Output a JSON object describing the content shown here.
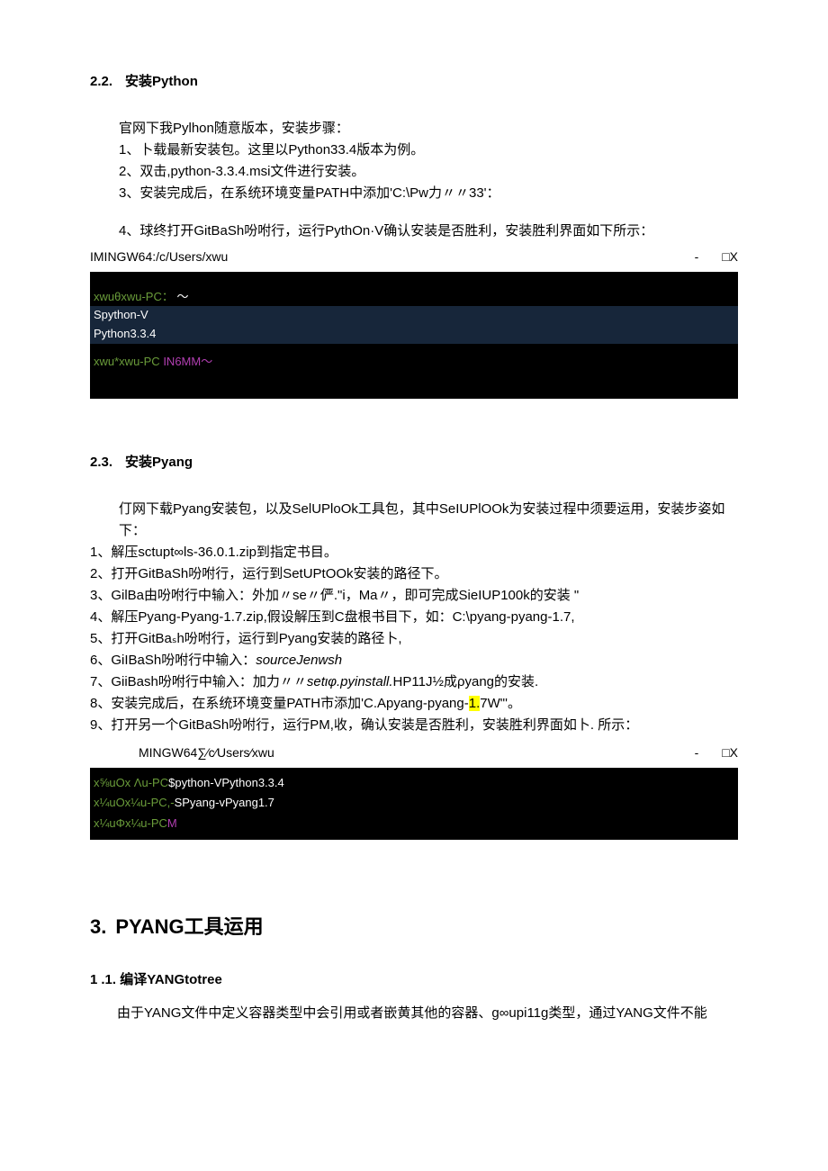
{
  "sec22": {
    "num": "2.2.",
    "title": "安装Python",
    "intro": "官网下我Pylhon随意版本，安装步骤：",
    "step1": "1、卜载最新安装包。这里以Python33.4版本为例。",
    "step2": "2、双击,python-3.3.4.msi文件进行安装。",
    "step3": "3、安装完成后，在系统环境变量PATH中添加'C:\\Pw力〃〃33'：",
    "step4": "4、球终打开GitBaSh吩咐行，运行PythOn·V确认安装是否胜利，安装胜利界面如下所示：",
    "term_title_left": "IMINGW64:/c/Users/xwu",
    "term_ctrl_min": "-",
    "term_ctrl_box": "□X",
    "t1l1_a": "xwuθxwu-PC：",
    "t1l1_b": "～",
    "t1l2": "Spython-V",
    "t1l3": "Python3.3.4",
    "t1l4_a": "xwu*xwu-PC",
    "t1l4_b": "IN6MM～"
  },
  "sec23": {
    "num": "2.3.",
    "title": "安装Pyang",
    "intro": "仃网下载Pyang安装包，以及SelUPloOk工具包，其中SeIUPlOOk为安装过程中须要运用，安装步姿如下：",
    "s1": "1、解压sctupt∞ls-36.0.1.zip到指定书目。",
    "s2": "2、打开GitBaSh吩咐行，运行到SetUPtOOk安装的路径下。",
    "s3": "3、GilBa由吩咐行中输入：外加〃se〃俨.\"i，Ma〃，即可完成SieIUP100k的安装 \"",
    "s4": "4、解压Pyang-Pyang-1.7.zip,假设解压到C盘根书目下，如：C:\\pyang-pyang-1.7,",
    "s5": "5、打开GitBaₛh吩咐行，运行到Pyang安装的路径卜,",
    "s6a": "6、GiIBaSh吩咐行中输入：",
    "s6b": "sourceJenwsh",
    "s7a": "7、GiiBash吩咐行中输入：加力〃〃",
    "s7b": "setιφ.pyinstall.",
    "s7c": "HP11J½成ρyang的安装.",
    "s8a": "8、安装完成后，在系统环境变量PATH市添加'C.Apyang-pyang-",
    "s8hl": "1.",
    "s8b": "7W\"'。",
    "s9": "9、打开另一个GitBaSh吩咐行，运行PM,收，确认安装是否胜利，安装胜利界面如卜. 所示：",
    "term_title_left": "MINGW64∑⁄c⁄Users⁄xwu",
    "term_ctrl_min": "-",
    "term_ctrl_box": "□X",
    "t2l1_a": "x⅝uOx Λu-PC",
    "t2l1_b": "$python-VPython3.3.4",
    "t2l2_a": "x¼uOx¼u-PC,-",
    "t2l2_b": "SPyang-vPyang1.7",
    "t2l3_a": "x¼uΦx¼u-PC",
    "t2l3_b": "M"
  },
  "chap3": {
    "num": "3.",
    "title": "PYANG工具运用",
    "sub_num": "1",
    "sub_title": ".1. 编译YANGtotree",
    "para": "由于YANG文件中定义容器类型中会引用或者嵌黄其他的容器、g∞upi11g类型，通过YANG文件不能"
  }
}
